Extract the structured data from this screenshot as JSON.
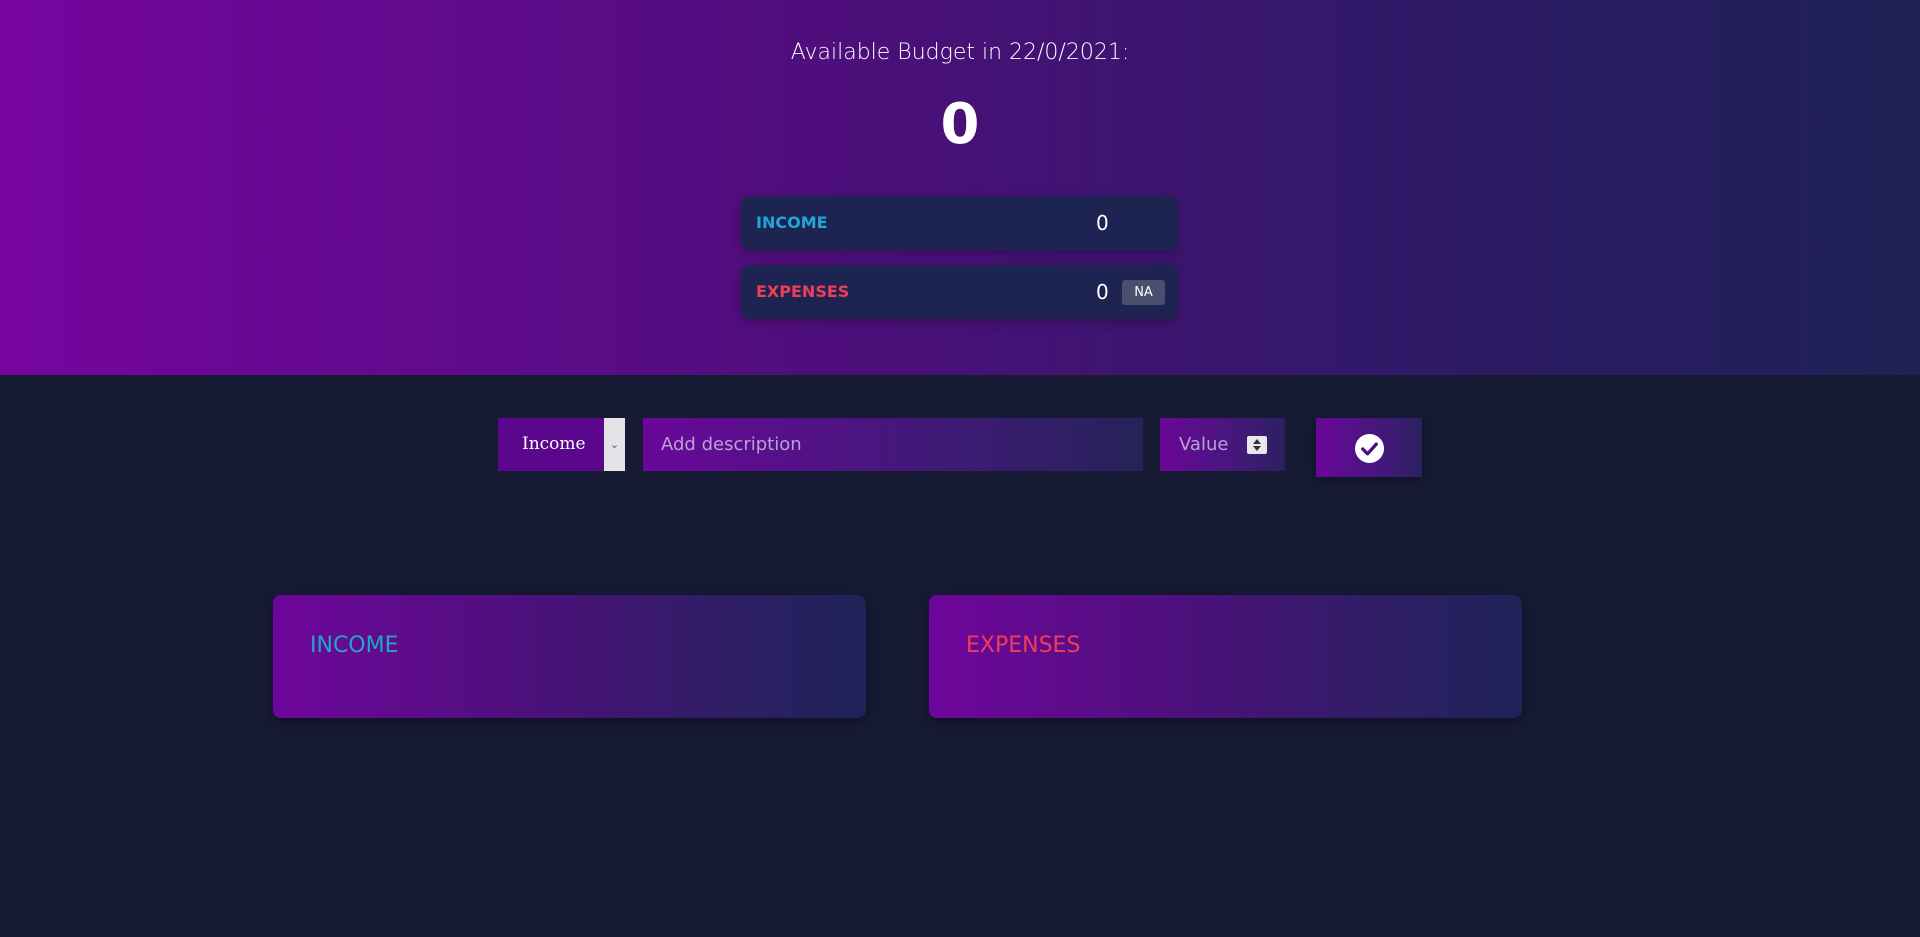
{
  "header": {
    "title": "Available Budget in 22/0/2021:",
    "budget": "0"
  },
  "summary": {
    "income": {
      "label": "INCOME",
      "value": "0"
    },
    "expenses": {
      "label": "EXPENSES",
      "value": "0",
      "percentage": "NA"
    }
  },
  "form": {
    "type_selected": "Income",
    "description_placeholder": "Add description",
    "value_placeholder": "Value",
    "submit_icon": "check-circle-icon"
  },
  "lists": {
    "income_title": "INCOME",
    "expenses_title": "EXPENSES"
  },
  "colors": {
    "income": "#22a6d8",
    "expenses": "#ef3e56",
    "background": "#161a33"
  }
}
